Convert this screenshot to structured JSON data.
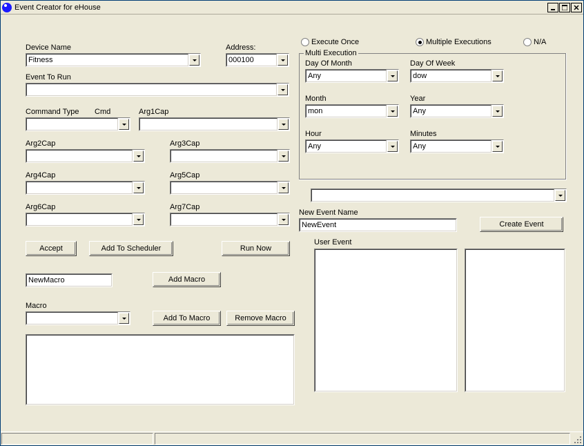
{
  "window": {
    "title": "Event Creator for eHouse"
  },
  "left": {
    "device_name_label": "Device Name",
    "device_name_value": "Fitness",
    "address_label": "Address:",
    "address_value": "000100",
    "event_to_run_label": "Event To Run",
    "event_to_run_value": "",
    "command_type_label": "Command Type",
    "cmd_label": "Cmd",
    "arg1_label": "Arg1Cap",
    "arg2_label": "Arg2Cap",
    "arg3_label": "Arg3Cap",
    "arg4_label": "Arg4Cap",
    "arg5_label": "Arg5Cap",
    "arg6_label": "Arg6Cap",
    "arg7_label": "Arg7Cap",
    "btn_accept": "Accept",
    "btn_add_scheduler": "Add To Scheduler",
    "btn_run_now": "Run Now",
    "macro_name_value": "NewMacro",
    "btn_add_macro": "Add Macro",
    "macro_label": "Macro",
    "btn_add_to_macro": "Add To Macro",
    "btn_remove_macro": "Remove Macro"
  },
  "top_radio": {
    "execute_once": "Execute Once",
    "multiple_exec": "Multiple Executions",
    "na": "N/A",
    "selected": "multiple"
  },
  "multi": {
    "group_title": "Multi Execution",
    "day_of_month_label": "Day Of Month",
    "day_of_month_value": "Any",
    "day_of_week_label": "Day Of Week",
    "day_of_week_value": "dow",
    "month_label": "Month",
    "month_value": "mon",
    "year_label": "Year",
    "year_value": "Any",
    "hour_label": "Hour",
    "hour_value": "Any",
    "minutes_label": "Minutes",
    "minutes_value": "Any"
  },
  "right": {
    "new_event_name_label": "New Event Name",
    "new_event_name_value": "NewEvent",
    "btn_create_event": "Create Event",
    "user_event_label": "User Event"
  }
}
